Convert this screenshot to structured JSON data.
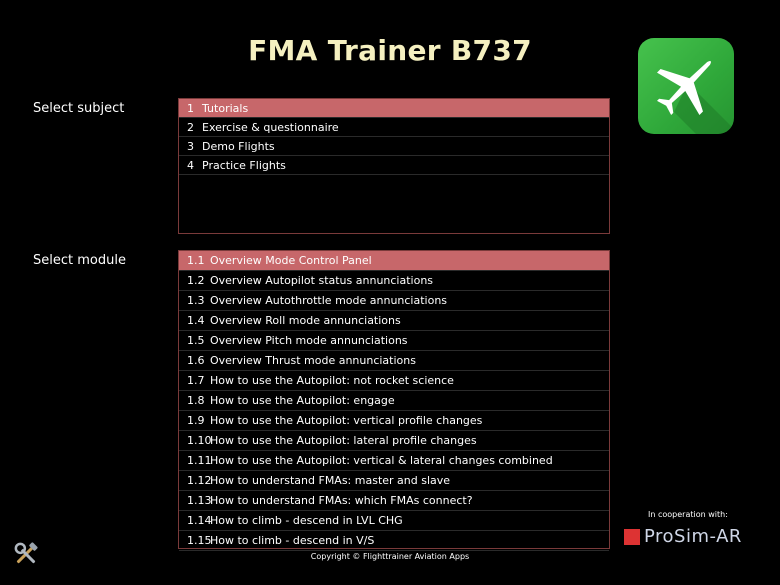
{
  "app": {
    "title": "FMA Trainer B737"
  },
  "labels": {
    "subject": "Select subject",
    "module": "Select module"
  },
  "subjects": [
    {
      "num": "1",
      "label": "Tutorials",
      "selected": true
    },
    {
      "num": "2",
      "label": "Exercise & questionnaire",
      "selected": false
    },
    {
      "num": "3",
      "label": "Demo Flights",
      "selected": false
    },
    {
      "num": "4",
      "label": "Practice Flights",
      "selected": false
    }
  ],
  "modules": [
    {
      "num": "1.1",
      "label": "Overview Mode Control Panel",
      "selected": true
    },
    {
      "num": "1.2",
      "label": "Overview Autopilot status annunciations"
    },
    {
      "num": "1.3",
      "label": "Overview Autothrottle mode annunciations"
    },
    {
      "num": "1.4",
      "label": "Overview Roll mode annunciations"
    },
    {
      "num": "1.5",
      "label": "Overview Pitch mode annunciations"
    },
    {
      "num": "1.6",
      "label": "Overview Thrust mode annunciations"
    },
    {
      "num": "1.7",
      "label": "How to use the Autopilot: not rocket science"
    },
    {
      "num": "1.8",
      "label": "How to use the Autopilot: engage"
    },
    {
      "num": "1.9",
      "label": "How to use the Autopilot: vertical profile changes"
    },
    {
      "num": "1.10",
      "label": "How to use the Autopilot: lateral profile changes"
    },
    {
      "num": "1.11",
      "label": "How to use the Autopilot: vertical & lateral changes combined"
    },
    {
      "num": "1.12",
      "label": "How to understand FMAs: master and slave"
    },
    {
      "num": "1.13",
      "label": "How to understand FMAs: which FMAs connect?"
    },
    {
      "num": "1.14",
      "label": "How to climb - descend in LVL CHG"
    },
    {
      "num": "1.15",
      "label": "How to climb - descend in V/S"
    }
  ],
  "footer": {
    "copyright": "Copyright © Flighttrainer Aviation Apps",
    "cooperation": "In cooperation with:",
    "partner": "ProSim-AR"
  },
  "icons": {
    "app": "airplane-icon",
    "tools": "tools-icon",
    "partner": "prosim-logo-icon"
  },
  "colors": {
    "selected": "#c7676a",
    "title": "#f5f0c0",
    "app_icon": "#3cb544"
  }
}
